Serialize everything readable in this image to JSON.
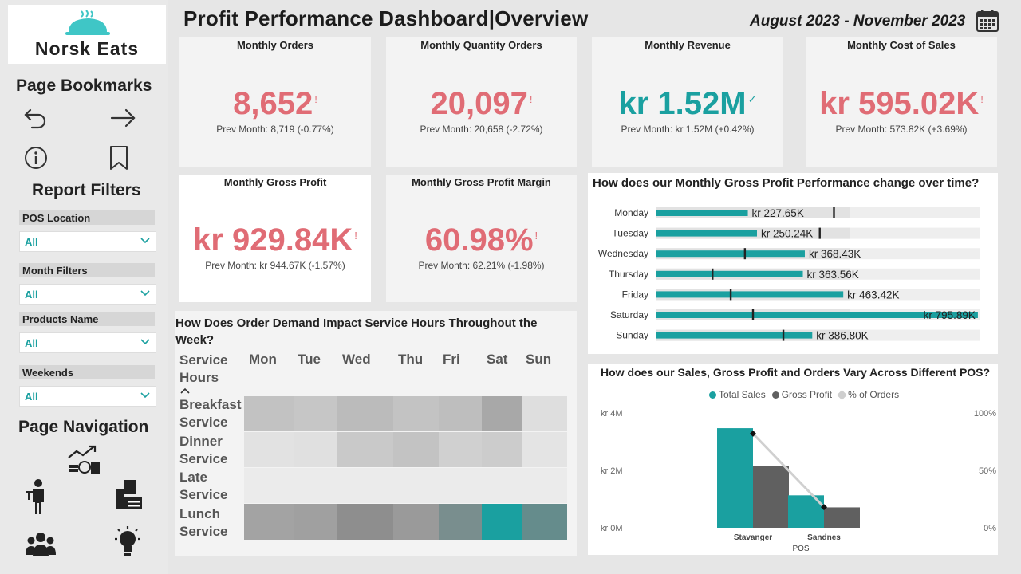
{
  "logo": {
    "name": "Norsk Eats"
  },
  "header": {
    "title": "Profit Performance Dashboard|Overview",
    "date_range": "August 2023 - November 2023"
  },
  "sidebar": {
    "bookmarks_title": "Page Bookmarks",
    "filters_title": "Report Filters",
    "filters": [
      {
        "label": "POS Location",
        "value": "All"
      },
      {
        "label": "Month Filters",
        "value": "All"
      },
      {
        "label": "Products Name",
        "value": "All"
      },
      {
        "label": "Weekends",
        "value": "All"
      }
    ],
    "nav_title": "Page Navigation"
  },
  "kpis": [
    {
      "title": "Monthly Orders",
      "value": "8,652",
      "mark": "!",
      "sub": "Prev Month: 8,719 (-0.77%)",
      "color": "#e06c75"
    },
    {
      "title": "Monthly Quantity Orders",
      "value": "20,097",
      "mark": "!",
      "sub": "Prev Month: 20,658 (-2.72%)",
      "color": "#e06c75"
    },
    {
      "title": "Monthly Revenue",
      "value": "kr 1.52M",
      "mark": "✓",
      "sub": "Prev Month: kr 1.52M (+0.42%)",
      "color": "#1aa0a0"
    },
    {
      "title": "Monthly Cost of Sales",
      "value": "kr 595.02K",
      "mark": "!",
      "sub": "Prev Month: 573.82K (+3.69%)",
      "color": "#e06c75"
    },
    {
      "title": "Monthly Gross Profit",
      "value": "kr 929.84K",
      "mark": "!",
      "sub": "Prev Month: kr 944.67K (-1.57%)",
      "color": "#e06c75"
    },
    {
      "title": "Monthly Gross Profit Margin",
      "value": "60.98%",
      "mark": "!",
      "sub": "Prev Month: 62.21% (-1.98%)",
      "color": "#e06c75"
    }
  ],
  "heatmap": {
    "title": "How Does Order Demand Impact Service Hours Throughout the Week?",
    "row_header": "Service Hours",
    "columns": [
      "Mon",
      "Tue",
      "Wed",
      "Thu",
      "Fri",
      "Sat",
      "Sun"
    ],
    "rows": [
      "Breakfast Service",
      "Dinner Service",
      "Late Service",
      "Lunch Service"
    ]
  },
  "chart_data": [
    {
      "type": "bar",
      "title": "How does our Monthly Gross Profit Performance change over time?",
      "categories": [
        "Monday",
        "Tuesday",
        "Wednesday",
        "Thursday",
        "Friday",
        "Saturday",
        "Sunday"
      ],
      "values": [
        227.65,
        250.24,
        368.43,
        363.56,
        463.42,
        795.89
      ],
      "value_labels": [
        "kr 227.65K",
        "kr 250.24K",
        "kr 368.43K",
        "kr 363.56K",
        "kr 463.42K",
        "kr 795.89K",
        "kr 386.80K"
      ],
      "values_all": [
        227.65,
        250.24,
        368.43,
        363.56,
        463.42,
        795.89,
        386.8
      ],
      "targets": [
        440,
        405,
        220,
        140,
        185,
        240,
        315
      ],
      "xlim": [
        0,
        800
      ],
      "unit": "K"
    },
    {
      "type": "bar",
      "title": "How does our Sales, Gross Profit and Orders Vary Across Different POS?",
      "categories": [
        "Stavanger",
        "Sandnes"
      ],
      "xlabel": "POS",
      "series": [
        {
          "name": "Total Sales",
          "values": [
            3.47,
            1.13
          ],
          "color": "#1aa0a0"
        },
        {
          "name": "Gross Profit",
          "values": [
            2.15,
            0.71
          ],
          "color": "#606060"
        },
        {
          "name": "% of Orders",
          "values": [
            0.82,
            0.18
          ],
          "color": "#cfcfcf"
        }
      ],
      "y_ticks": [
        "kr 4M",
        "kr 2M",
        "kr 0M"
      ],
      "y2_ticks": [
        "100%",
        "50%",
        "0%"
      ],
      "ylim": [
        0,
        4
      ],
      "y2lim": [
        0,
        1
      ]
    }
  ]
}
